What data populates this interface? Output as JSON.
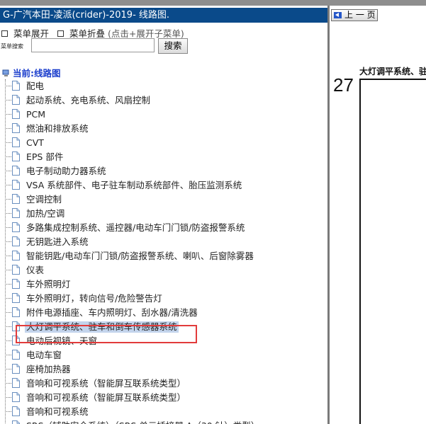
{
  "window_title": "G-广汽本田-凌派(crider)-2019- 线路图.",
  "menu_expand": "菜单展开",
  "menu_collapse": "菜单折叠",
  "menu_hint": "(点击+展开子菜单)",
  "search_label": "菜单搜索",
  "search_button": "搜索",
  "search_value": "",
  "current_label": "当前:线路图",
  "tree_items": [
    "配电",
    "起动系统、充电系统、风扇控制",
    "PCM",
    "燃油和排放系统",
    "CVT",
    "EPS 部件",
    "电子制动助力器系统",
    "VSA 系统部件、电子驻车制动系统部件、胎压监测系统",
    "空调控制",
    "加热/空调",
    "多路集成控制系统、遥控器/电动车门门锁/防盗报警系统",
    "无钥匙进入系统",
    "智能钥匙/电动车门门锁/防盗报警系统、喇叭、后窗除雾器",
    "仪表",
    "车外照明灯",
    "车外照明灯，转向信号/危险警告灯",
    "附件电源插座、车内照明灯、刮水器/清洗器",
    "大灯调平系统、驻车和倒车传感器系统",
    "电动后视镜、天窗",
    "电动车窗",
    "座椅加热器",
    "音响和可视系统（智能屏互联系统类型）",
    "音响和可视系统（智能屏互联系统类型）",
    "音响和可视系统",
    "SRS（辅助安全系统）（SRS 单元插接器 A（30 针）类型）"
  ],
  "selected_index": 17,
  "prev_button": "上 一 页",
  "page_number": "27",
  "page_title": "大灯调平系统、驻",
  "colors": {
    "titlebar": "#0a4a8a",
    "current": "#1a3dcc",
    "selected_bg": "#c3d4ec",
    "highlight": "#e23b3b"
  }
}
